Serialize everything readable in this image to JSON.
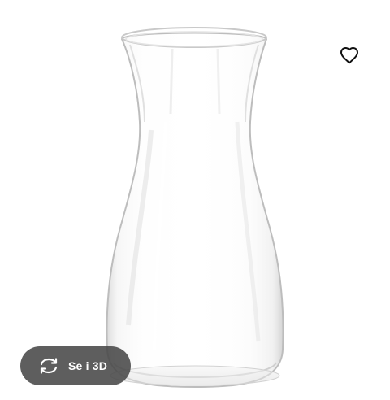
{
  "product": {
    "image_icon": "glass-carafe"
  },
  "favorite": {
    "icon": "heart-outline-icon"
  },
  "view3d": {
    "icon": "rotate-3d-icon",
    "label": "Se i 3D"
  },
  "colors": {
    "button_bg": "#484848",
    "button_text": "#ffffff",
    "heart": "#111111"
  }
}
